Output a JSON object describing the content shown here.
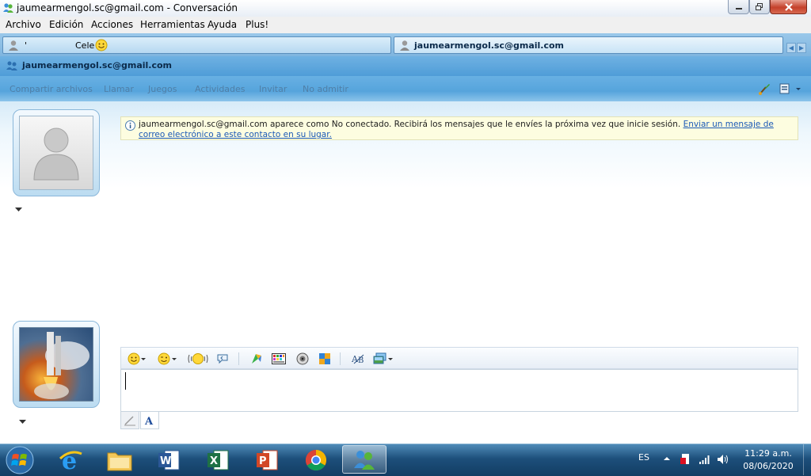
{
  "window": {
    "title": "jaumearmengol.sc@gmail.com - Conversación"
  },
  "menu": {
    "items": [
      "Archivo",
      "Edición",
      "Acciones",
      "Herramientas",
      "Ayuda",
      "Plus!"
    ]
  },
  "tabs": [
    {
      "label": "'",
      "nickname": "Cele"
    },
    {
      "label": "jaumearmengol.sc@gmail.com"
    }
  ],
  "conversation": {
    "header": "jaumearmengol.sc@gmail.com"
  },
  "toolbar": {
    "items": [
      "Compartir archivos",
      "Llamar",
      "Juegos",
      "Actividades",
      "Invitar",
      "No admitir"
    ]
  },
  "info": {
    "message": "jaumearmengol.sc@gmail.com aparece como No conectado. Recibirá los mensajes que le envíes la próxima vez que inicie sesión.",
    "link": "Enviar un mensaje de correo electrónico a este contacto en su lugar."
  },
  "taskbar": {
    "apps": [
      "internet-explorer-icon",
      "file-explorer-icon",
      "word-icon",
      "excel-icon",
      "powerpoint-icon",
      "chrome-icon",
      "messenger-icon"
    ],
    "language": "ES",
    "time": "11:29 a.m.",
    "date": "08/06/2020"
  },
  "colors": {
    "accent": "#56a4dc",
    "link": "#1b59b6",
    "info_bg": "#fdfde0"
  }
}
